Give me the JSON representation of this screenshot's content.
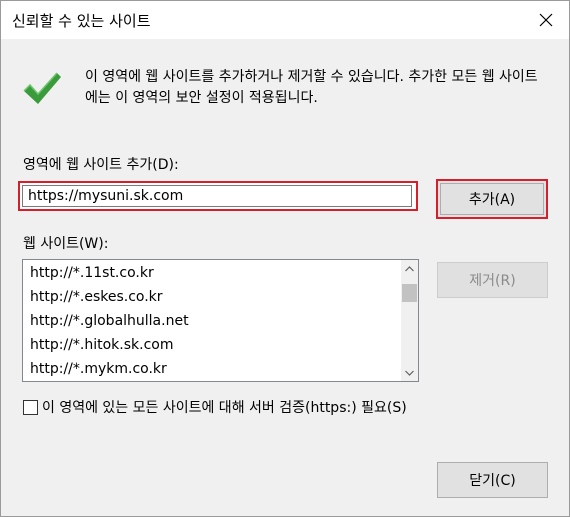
{
  "window": {
    "title": "신뢰할 수 있는 사이트",
    "close_icon": "close-icon"
  },
  "info": {
    "icon": "checkmark-icon",
    "text": "이 영역에 웹 사이트를 추가하거나 제거할 수 있습니다. 추가한 모든 웹 사이트에는 이 영역의 보안 설정이 적용됩니다."
  },
  "add_site": {
    "label": "영역에 웹 사이트 추가(D):",
    "input_value": "https://mysuni.sk.com",
    "add_button": "추가(A)"
  },
  "sites": {
    "label": "웹 사이트(W):",
    "items": [
      "http://*.11st.co.kr",
      "http://*.eskes.co.kr",
      "http://*.globalhulla.net",
      "http://*.hitok.sk.com",
      "http://*.mykm.co.kr"
    ],
    "remove_button": "제거(R)"
  },
  "https_check": {
    "checked": false,
    "label": "이 영역에 있는 모든 사이트에 대해 서버 검증(https:) 필요(S)"
  },
  "footer": {
    "close_button": "닫기(C)"
  },
  "colors": {
    "highlight": "#d61f2c",
    "check_green": "#3a9b3a",
    "dialog_bg": "#f0f0f0"
  }
}
